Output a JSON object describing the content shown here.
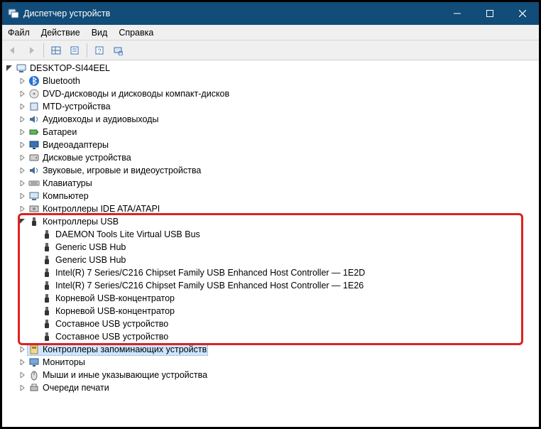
{
  "title": "Диспетчер устройств",
  "menu": {
    "file": "Файл",
    "action": "Действие",
    "view": "Вид",
    "help": "Справка"
  },
  "root": "DESKTOP-SI44EEL",
  "categories": [
    {
      "label": "Bluetooth",
      "icon": "bluetooth"
    },
    {
      "label": "DVD-дисководы и дисководы компакт-дисков",
      "icon": "dvd"
    },
    {
      "label": "MTD-устройства",
      "icon": "mtd"
    },
    {
      "label": "Аудиовходы и аудиовыходы",
      "icon": "audio"
    },
    {
      "label": "Батареи",
      "icon": "battery"
    },
    {
      "label": "Видеоадаптеры",
      "icon": "display"
    },
    {
      "label": "Дисковые устройства",
      "icon": "disk"
    },
    {
      "label": "Звуковые, игровые и видеоустройства",
      "icon": "audio"
    },
    {
      "label": "Клавиатуры",
      "icon": "keyboard"
    },
    {
      "label": "Компьютер",
      "icon": "computer"
    },
    {
      "label": "Контроллеры IDE ATA/ATAPI",
      "icon": "ide"
    },
    {
      "label": "Контроллеры USB",
      "icon": "usb",
      "expanded": true,
      "children": [
        "DAEMON Tools Lite Virtual USB Bus",
        "Generic USB Hub",
        "Generic USB Hub",
        "Intel(R) 7 Series/C216 Chipset Family USB Enhanced Host Controller — 1E2D",
        "Intel(R) 7 Series/C216 Chipset Family USB Enhanced Host Controller — 1E26",
        "Корневой USB-концентратор",
        "Корневой USB-концентратор",
        "Составное USB устройство",
        "Составное USB устройство"
      ]
    },
    {
      "label": "Контроллеры запоминающих устройств",
      "icon": "storage",
      "selected": true
    },
    {
      "label": "Мониторы",
      "icon": "monitor"
    },
    {
      "label": "Мыши и иные указывающие устройства",
      "icon": "mouse"
    },
    {
      "label": "Очереди печати",
      "icon": "printer"
    }
  ]
}
